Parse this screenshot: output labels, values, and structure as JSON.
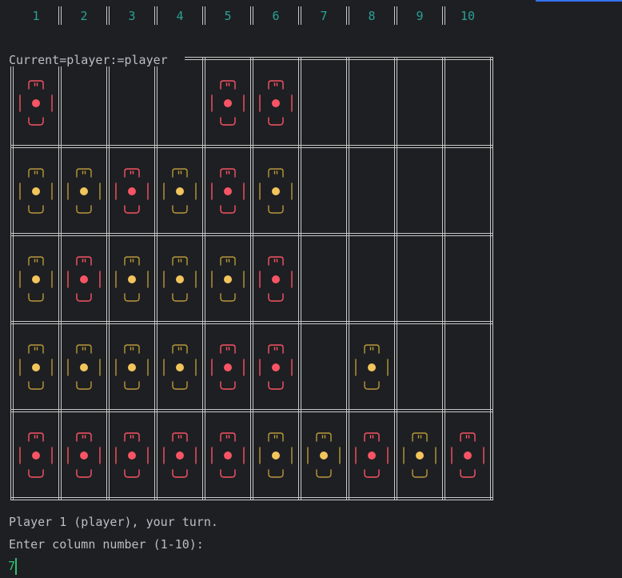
{
  "terminal": {
    "column_numbers": [
      "1",
      "2",
      "3",
      "4",
      "5",
      "6",
      "7",
      "8",
      "9",
      "10"
    ],
    "status_line": "Current=player:=player",
    "board": [
      [
        "R",
        "",
        "",
        "",
        "R",
        "R",
        "",
        "",
        "",
        ""
      ],
      [
        "Y",
        "Y",
        "R",
        "Y",
        "R",
        "Y",
        "",
        "",
        "",
        ""
      ],
      [
        "Y",
        "R",
        "Y",
        "Y",
        "Y",
        "R",
        "",
        "",
        "",
        ""
      ],
      [
        "Y",
        "Y",
        "Y",
        "Y",
        "R",
        "R",
        "",
        "Y",
        "",
        ""
      ],
      [
        "R",
        "R",
        "R",
        "R",
        "R",
        "Y",
        "Y",
        "R",
        "Y",
        "R"
      ]
    ],
    "prompt_turn": "Player 1 (player), your turn.",
    "prompt_input": "Enter column number (1-10):",
    "input_value": "7"
  },
  "colors": {
    "background": "#1e1f22",
    "text": "#bcbec4",
    "column_number": "#2aa198",
    "grid": "#c8c8c8",
    "red_piece": "#f75464",
    "yellow_piece": "#f2c55c",
    "yellow_bracket": "#b89a3a",
    "cursor": "#2fbf71",
    "accent_blue": "#3574f0"
  },
  "icons": {
    "red_piece": "red-disc-icon",
    "yellow_piece": "yellow-disc-icon"
  }
}
